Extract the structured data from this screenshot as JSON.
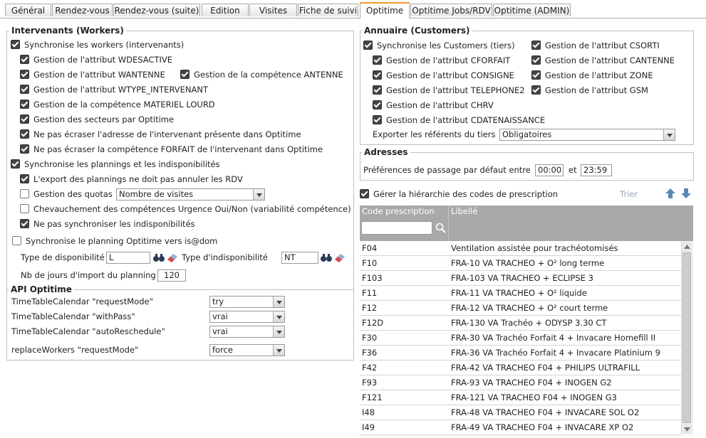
{
  "tabs": [
    "Général",
    "Rendez-vous",
    "Rendez-vous (suite)",
    "Edition",
    "Visites",
    "Fiche de suivi",
    "Optitime",
    "Optitime Jobs/RDV",
    "Optitime (ADMIN)"
  ],
  "active_tab": "Optitime",
  "workers": {
    "title": "Intervenants (Workers)",
    "sync_workers": "Synchronise les workers (intervenants)",
    "wdesactive": "Gestion de l'attribut WDESACTIVE",
    "wantenne": "Gestion de l'attribut WANTENNE",
    "comp_antenne": "Gestion de la compétence ANTENNE",
    "wtype": "Gestion de l'attribut WTYPE_INTERVENANT",
    "materiel": "Gestion de la compétence MATERIEL LOURD",
    "secteurs": "Gestion des secteurs par Optitime",
    "no_adresse": "Ne pas écraser l'adresse de l'intervenant présente dans Optitime",
    "no_forfait": "Ne pas écraser la compétence FORFAIT de l'intervenant dans Optitime",
    "sync_plannings": "Synchronise les plannings et les indisponibilités",
    "export_rdv": "L'export des plannings ne doit pas annuler les RDV",
    "quotas": "Gestion des quotas",
    "quotas_value": "Nombre de visites",
    "chevauchement": "Chevauchement des compétences Urgence Oui/Non (variabilité compétence)",
    "no_sync_indispo": "Ne pas synchroniser les indisponibilités",
    "sync_isdom": "Synchronise le planning Optitime vers is@dom",
    "dispo_label": "Type de disponibilité",
    "dispo_value": "L",
    "indispo_label": "Type d'indisponibilité",
    "indispo_value": "NT",
    "nbjours_label": "Nb de jours d'import du planning",
    "nbjours_value": "120"
  },
  "api": {
    "title": "API Optitime",
    "rows": [
      {
        "label": "TimeTableCalendar \"requestMode\"",
        "value": "try"
      },
      {
        "label": "TimeTableCalendar \"withPass\"",
        "value": "vrai"
      },
      {
        "label": "TimeTableCalendar \"autoReschedule\"",
        "value": "vrai"
      },
      {
        "label": "replaceWorkers \"requestMode\"",
        "value": "force"
      }
    ]
  },
  "customers": {
    "title": "Annuaire (Customers)",
    "sync": "Synchronise les Customers (tiers)",
    "cforfait": "Gestion de l'attribut CFORFAIT",
    "consigne": "Gestion de l'attribut CONSIGNE",
    "telephone2": "Gestion de l'attribut TELEPHONE2",
    "chrv": "Gestion de l'attribut CHRV",
    "cdatenaissance": "Gestion de l'attribut CDATENAISSANCE",
    "csorti": "Gestion de l'attribut CSORTI",
    "cantenne": "Gestion de l'attribut CANTENNE",
    "zone": "Gestion de l'attribut ZONE",
    "gsm": "Gestion de l'attribut GSM",
    "export_label": "Exporter les référents du tiers",
    "export_value": "Obligatoires"
  },
  "adresses": {
    "title": "Adresses",
    "label": "Préférences de passage par défaut entre",
    "from": "00:00",
    "and": "et",
    "to": "23:59"
  },
  "prescription": {
    "manage_label": "Gérer la hiérarchie des codes de prescription",
    "sort_label": "Trier",
    "col_code": "Code prescription",
    "col_libelle": "Libellé",
    "rows": [
      {
        "code": "F04",
        "libelle": "Ventilation assistée pour trachéotomisés"
      },
      {
        "code": "F10",
        "libelle": "FRA-10 VA TRACHEO + O² long terme"
      },
      {
        "code": "F103",
        "libelle": "FRA-103 VA TRACHEO  + ECLIPSE 3"
      },
      {
        "code": "F11",
        "libelle": "FRA-11 VA TRACHEO + O² liquide"
      },
      {
        "code": "F12",
        "libelle": "FRA-12 VA TRACHEO + O² court terme"
      },
      {
        "code": "F12D",
        "libelle": "FRA-130 VA Trachéo + ODYSP 3.30 CT"
      },
      {
        "code": "F30",
        "libelle": "FRA-30 VA Trachéo Forfait 4 + Invacare Homefill II"
      },
      {
        "code": "F36",
        "libelle": "FRA-36 VA Trachéo Forfait 4 + Invacare Platinium 9"
      },
      {
        "code": "F42",
        "libelle": "FRA-42 VA TRACHEO F04 + PHILIPS ULTRAFILL"
      },
      {
        "code": "F93",
        "libelle": "FRA-93 VA TRACHEO F04 + INOGEN G2"
      },
      {
        "code": "F121",
        "libelle": "FRA-121 VA TRACHEO F04 + INOGEN G3"
      },
      {
        "code": "I48",
        "libelle": "FRA-48 VA TRACHEO F04 + INVACARE SOL O2"
      },
      {
        "code": "I49",
        "libelle": "FRA-49 VA TRACHEO F04 + INVACARE XP O2"
      }
    ]
  }
}
